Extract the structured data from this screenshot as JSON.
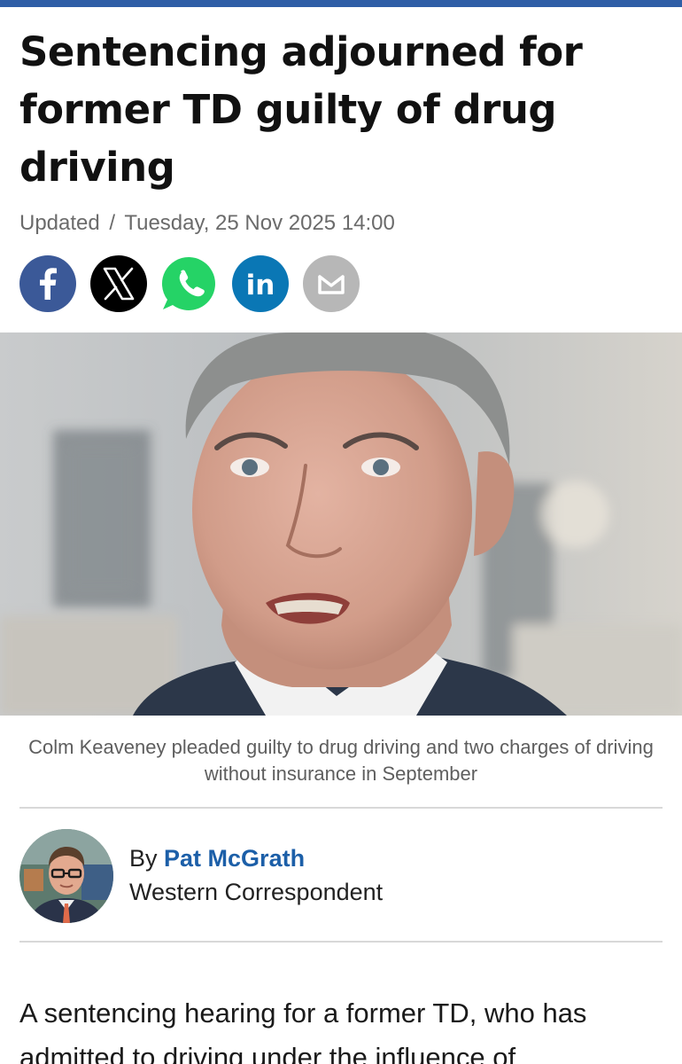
{
  "article": {
    "headline": "Sentencing adjourned for former TD guilty of drug driving",
    "updated_label": "Updated",
    "separator": "/",
    "timestamp": "Tuesday, 25 Nov 2025 14:00",
    "caption": "Colm Keaveney pleaded guilty to drug driving and two charges of driving without insurance in September",
    "byline_prefix": "By",
    "author_name": "Pat McGrath",
    "author_role": "Western Correspondent",
    "body_preview": "A sentencing hearing for a former TD, who has admitted to driving under the influence of"
  },
  "share": [
    {
      "icon": "facebook-icon",
      "color": "#3b5998"
    },
    {
      "icon": "x-icon",
      "color": "#000000"
    },
    {
      "icon": "whatsapp-icon",
      "color": "#25d366"
    },
    {
      "icon": "linkedin-icon",
      "color": "#0a77b5"
    },
    {
      "icon": "email-icon",
      "color": "#b7b7b7"
    }
  ],
  "theme": {
    "accent": "#2f5ea6",
    "link": "#1c5fa8"
  }
}
